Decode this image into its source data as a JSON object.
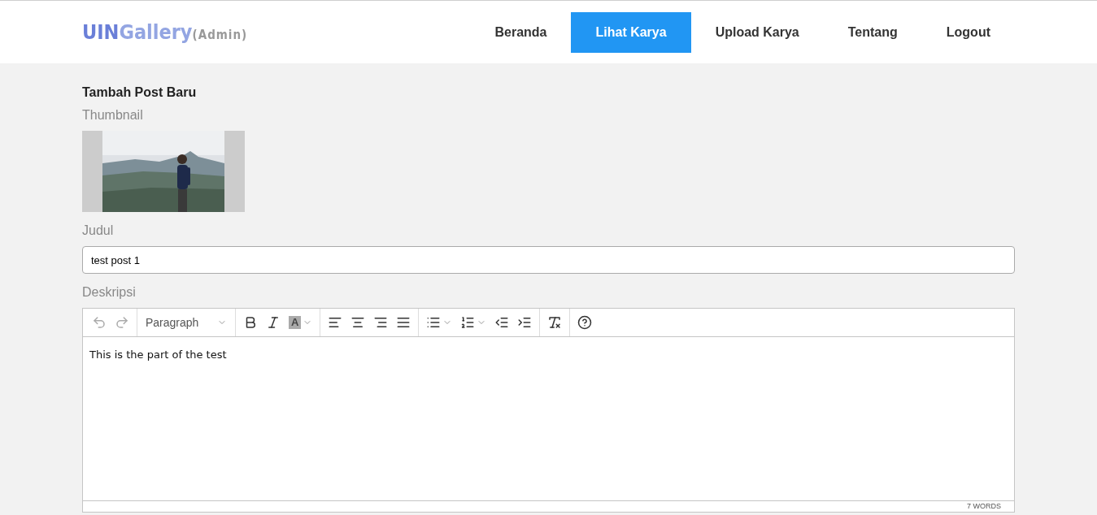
{
  "logo": {
    "parts": [
      "UIN",
      "Gallery",
      "(Admin)"
    ]
  },
  "nav": [
    {
      "label": "Beranda",
      "selected": false
    },
    {
      "label": "Lihat Karya",
      "selected": true
    },
    {
      "label": "Upload Karya",
      "selected": false
    },
    {
      "label": "Tentang",
      "selected": false
    },
    {
      "label": "Logout",
      "selected": false
    }
  ],
  "form": {
    "title": "Tambah Post Baru",
    "thumbnail_label": "Thumbnail",
    "judul_label": "Judul",
    "judul_value": "test post 1",
    "deskripsi_label": "Deskripsi"
  },
  "editor": {
    "block_format": "Paragraph",
    "text_color_letter": "A",
    "undo_disabled": true,
    "redo_disabled": true,
    "content": "This is the part of the test",
    "word_count": "7 WORDS"
  }
}
